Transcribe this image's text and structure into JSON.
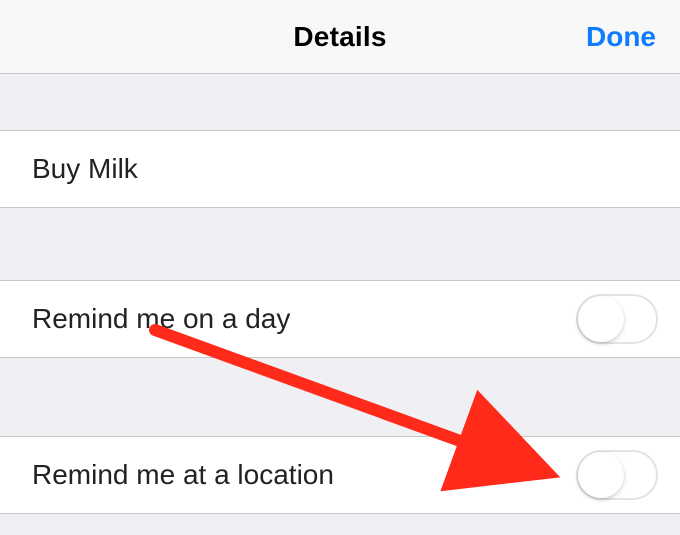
{
  "nav": {
    "title": "Details",
    "done": "Done"
  },
  "reminder": {
    "title": "Buy Milk"
  },
  "options": {
    "remind_day": {
      "label": "Remind me on a day",
      "value": false
    },
    "remind_location": {
      "label": "Remind me at a location",
      "value": false
    }
  },
  "annotation": {
    "arrow_color": "#ff2a1a"
  }
}
